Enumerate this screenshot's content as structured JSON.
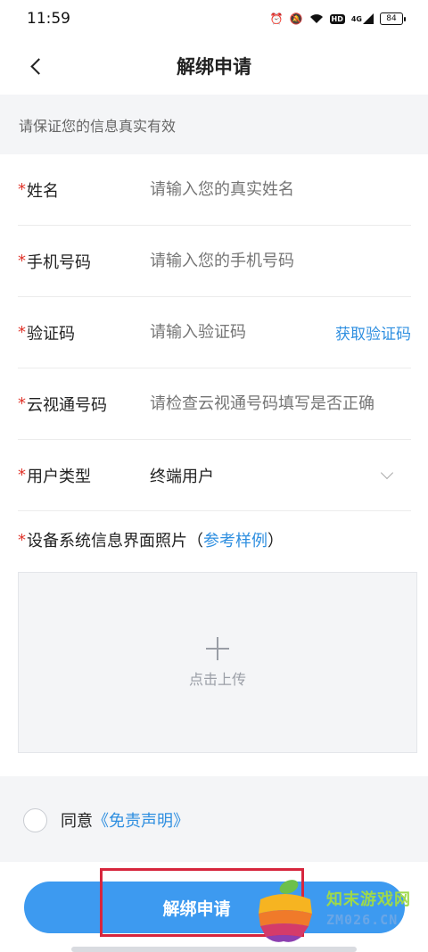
{
  "status_bar": {
    "time": "11:59",
    "icons": [
      "alarm-icon",
      "mute-bell-icon",
      "wifi-icon",
      "hd-icon",
      "signal-4g-icon",
      "battery-icon"
    ],
    "hd": "HD",
    "network": "4G",
    "battery": "84"
  },
  "header": {
    "title": "解绑申请",
    "back_icon": "chevron-left-icon"
  },
  "notice": "请保证您的信息真实有效",
  "form": {
    "required_mark": "*",
    "name": {
      "label": "姓名",
      "placeholder": "请输入您的真实姓名"
    },
    "phone": {
      "label": "手机号码",
      "placeholder": "请输入您的手机号码"
    },
    "code": {
      "label": "验证码",
      "placeholder": "请输入验证码",
      "button": "获取验证码"
    },
    "account": {
      "label": "云视通号码",
      "placeholder": "请检查云视通号码填写是否正确"
    },
    "user_type": {
      "label": "用户类型",
      "value": "终端用户"
    },
    "photo": {
      "label": "设备系统信息界面照片（",
      "sample_link": "参考样例",
      "label_end": "）",
      "upload_text": "点击上传"
    }
  },
  "agreement": {
    "text": "同意",
    "link": "《免责声明》",
    "checked": false
  },
  "submit_label": "解绑申请",
  "watermark": {
    "title": "知末游戏网",
    "url": "ZM026.CN"
  },
  "colors": {
    "accent": "#3d9af0",
    "link": "#2f8fe0",
    "required": "#e0352b",
    "highlight": "#d7263d"
  }
}
